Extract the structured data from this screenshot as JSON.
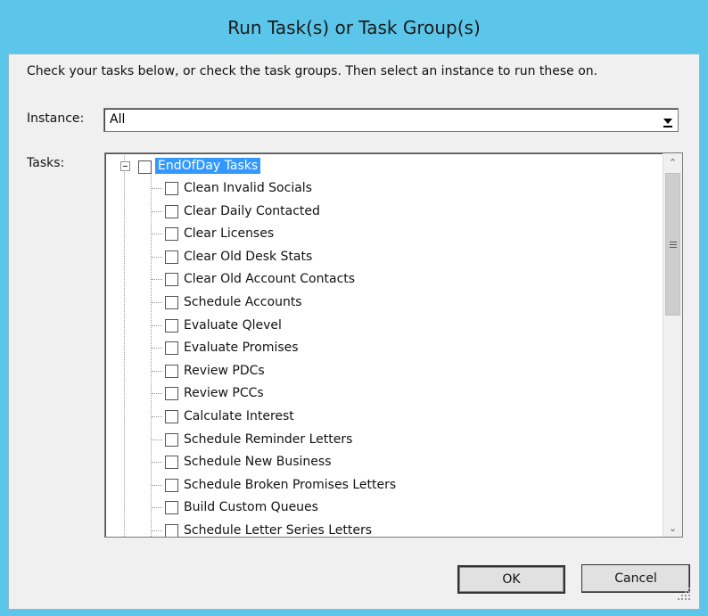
{
  "window": {
    "title": "Run Task(s) or Task Group(s)"
  },
  "instructions": "Check your tasks below, or check the task groups.  Then select an instance to run these on.",
  "instance": {
    "label": "Instance:",
    "value": "All"
  },
  "tasks": {
    "label": "Tasks:",
    "root": {
      "label": "EndOfDay Tasks",
      "checked": false,
      "expanded": true
    },
    "items": [
      {
        "label": "Clean Invalid Socials",
        "checked": false
      },
      {
        "label": "Clear Daily Contacted",
        "checked": false
      },
      {
        "label": "Clear Licenses",
        "checked": false
      },
      {
        "label": "Clear Old Desk Stats",
        "checked": false
      },
      {
        "label": "Clear Old Account Contacts",
        "checked": false
      },
      {
        "label": "Schedule Accounts",
        "checked": false
      },
      {
        "label": "Evaluate Qlevel",
        "checked": false
      },
      {
        "label": "Evaluate Promises",
        "checked": false
      },
      {
        "label": "Review PDCs",
        "checked": false
      },
      {
        "label": "Review PCCs",
        "checked": false
      },
      {
        "label": "Calculate Interest",
        "checked": false
      },
      {
        "label": "Schedule Reminder Letters",
        "checked": false
      },
      {
        "label": "Schedule New Business",
        "checked": false
      },
      {
        "label": "Schedule Broken Promises Letters",
        "checked": false
      },
      {
        "label": "Build Custom Queues",
        "checked": false
      },
      {
        "label": "Schedule Letter Series Letters",
        "checked": false
      }
    ]
  },
  "buttons": {
    "ok": "OK",
    "cancel": "Cancel"
  },
  "icons": {
    "scroll_up": "chevron-up-icon",
    "scroll_down": "chevron-down-icon",
    "combo_arrow": "dropdown-arrow-icon",
    "collapse": "collapse-minus-icon",
    "resize": "resize-grip-icon"
  },
  "colors": {
    "title_bar": "#5cc6ea",
    "client_bg": "#f0f0f0",
    "selection": "#3399ff"
  }
}
